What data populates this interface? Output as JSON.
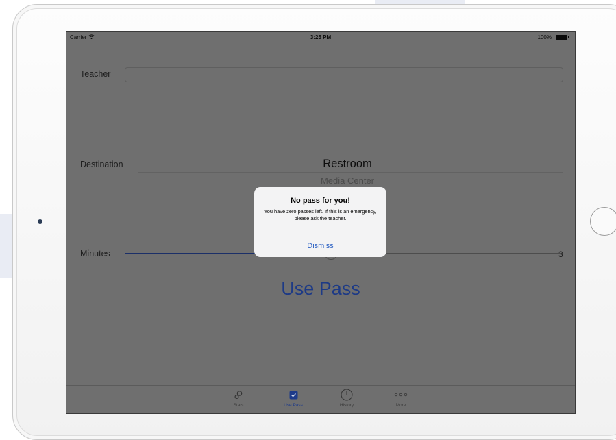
{
  "status_bar": {
    "carrier": "Carrier",
    "time": "3:25 PM",
    "battery": "100%"
  },
  "form": {
    "teacher_label": "Teacher",
    "teacher_value": "",
    "destination_label": "Destination",
    "destination_selected": "Restroom",
    "destination_next": "Media Center",
    "minutes_label": "Minutes",
    "minutes_value": "3",
    "use_pass_label": "Use Pass"
  },
  "tabbar": {
    "tabs": [
      {
        "label": "Stats",
        "icon": "stats-icon",
        "active": false
      },
      {
        "label": "Use Pass",
        "icon": "checkbox-icon",
        "active": true
      },
      {
        "label": "History",
        "icon": "clock-icon",
        "active": false
      },
      {
        "label": "More",
        "icon": "more-icon",
        "active": false
      }
    ]
  },
  "alert": {
    "title": "No pass for you!",
    "message": "You have zero passes left. If this is an emergency, please ask the teacher.",
    "dismiss_label": "Dismiss"
  },
  "colors": {
    "accent": "#2d62c4",
    "dimmed_accent": "#1d3a86",
    "dim_overlay": "#6f6f6f"
  }
}
